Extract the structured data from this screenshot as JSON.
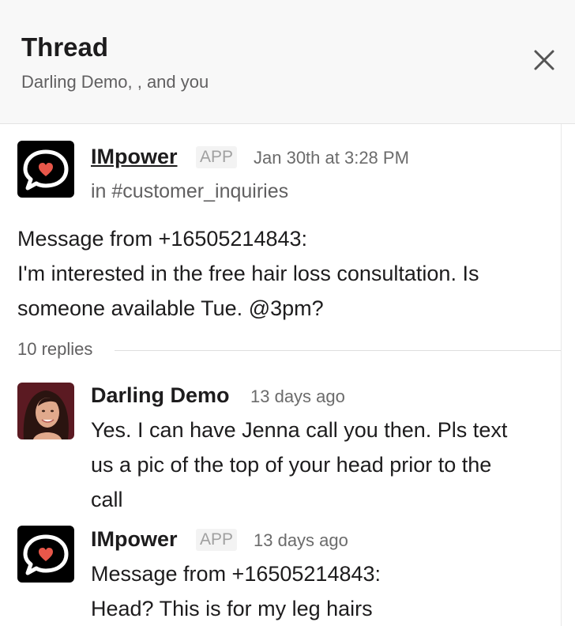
{
  "header": {
    "title": "Thread",
    "subtitle": "Darling Demo, , and you",
    "close_icon": "close-icon"
  },
  "parent_message": {
    "author": "IMpower",
    "badge": "APP",
    "timestamp": "Jan 30th at 3:28 PM",
    "channel": "in #customer_inquiries",
    "lines": [
      "Message from +16505214843:",
      "I'm interested in the free hair loss consultation. Is",
      "someone available Tue. @3pm?"
    ],
    "avatar_icon": "chat-bubble-heart-icon"
  },
  "replies_label": "10 replies",
  "replies": [
    {
      "author": "Darling Demo",
      "timestamp": "13 days ago",
      "lines": [
        "Yes. I can have Jenna call you then. Pls text",
        "us a pic of the top of your head prior to the",
        "call"
      ]
    },
    {
      "author": "IMpower",
      "badge": "APP",
      "timestamp": "13 days ago",
      "lines": [
        "Message from +16505214843:",
        "Head? This is for my leg hairs"
      ],
      "avatar_icon": "chat-bubble-heart-icon"
    }
  ],
  "colors": {
    "header_bg": "#f8f8f8",
    "heart": "#e8574a",
    "text": "#1d1c1d",
    "muted": "#616061"
  }
}
